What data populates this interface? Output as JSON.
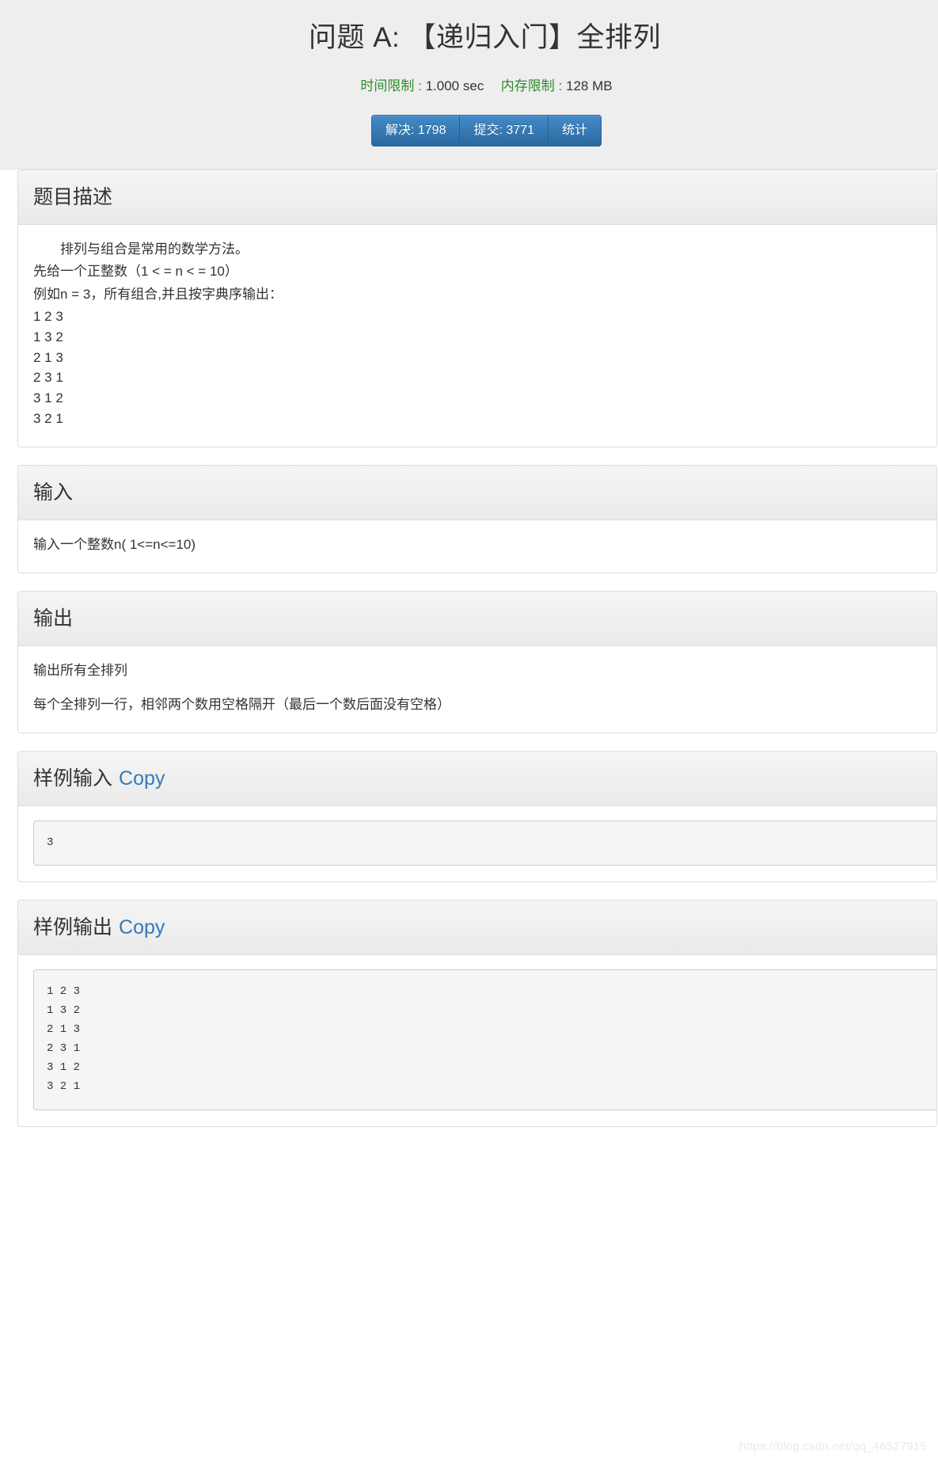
{
  "header": {
    "title": "问题 A: 【递归入门】全排列",
    "time_limit_label": "时间限制 :",
    "time_limit_value": "1.000 sec",
    "memory_limit_label": "内存限制 :",
    "memory_limit_value": "128 MB",
    "buttons": [
      {
        "name": "solved",
        "label": "解决: 1798"
      },
      {
        "name": "submit",
        "label": "提交: 3771"
      },
      {
        "name": "statistics",
        "label": "统计"
      }
    ],
    "accent_color": "#428bca",
    "label_color": "#2e8b2e"
  },
  "sections": {
    "description": {
      "title": "题目描述",
      "paragraph1": "排列与组合是常用的数学方法。",
      "paragraph2": "先给一个正整数（1 < = n < = 10）",
      "paragraph3": "例如n = 3，所有组合,并且按字典序输出：",
      "permutations": [
        "1 2 3",
        "1 3 2",
        "2 1 3",
        "2 3 1",
        "3 1 2",
        "3 2 1"
      ]
    },
    "input": {
      "title": "输入",
      "text": "输入一个整数n(  1<=n<=10)"
    },
    "output": {
      "title": "输出",
      "line1": "输出所有全排列",
      "line2": "每个全排列一行，相邻两个数用空格隔开（最后一个数后面没有空格）"
    },
    "sample_input": {
      "title": "样例输入",
      "copy_label": "Copy",
      "content": "3"
    },
    "sample_output": {
      "title": "样例输出",
      "copy_label": "Copy",
      "content": "1 2 3\n1 3 2\n2 1 3\n2 3 1\n3 1 2\n3 2 1"
    }
  },
  "watermark": "https://blog.csdn.net/qq_46527915"
}
